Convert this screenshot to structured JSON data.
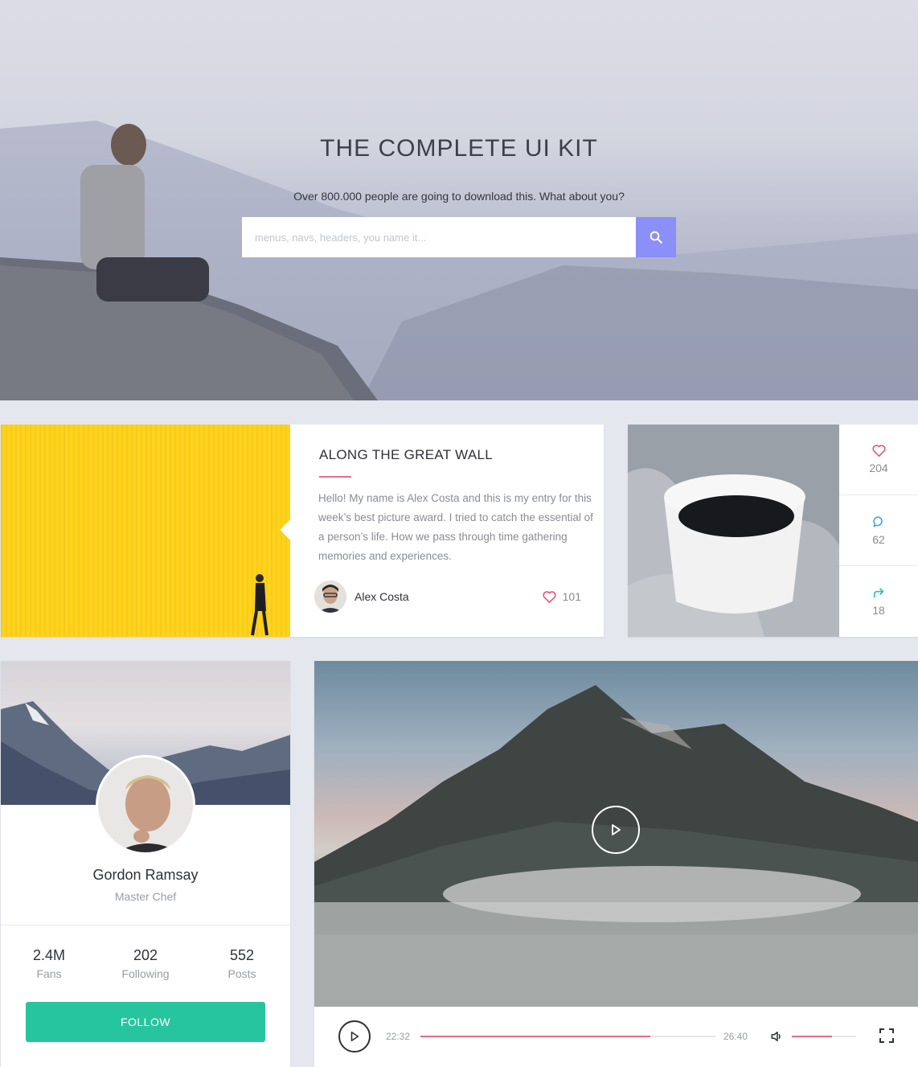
{
  "hero": {
    "title": "THE COMPLETE UI KIT",
    "subtitle": "Over 800.000 people are going to download this. What about you?",
    "search_placeholder": "menus, navs, headers, you name it...",
    "search_value": ""
  },
  "blog": {
    "title": "ALONG THE GREAT WALL",
    "body": "Hello! My name is Alex Costa and this is my entry for this week’s best picture award. I tried to catch the essential of a person’s life. How we pass through time gathering memories and experiences.",
    "author": "Alex Costa",
    "likes": "101"
  },
  "coffee": {
    "stats": [
      {
        "icon": "heart-icon",
        "value": "204"
      },
      {
        "icon": "comment-icon",
        "value": "62"
      },
      {
        "icon": "share-icon",
        "value": "18"
      }
    ]
  },
  "profile": {
    "name": "Gordon Ramsay",
    "role": "Master Chef",
    "stats": [
      {
        "value": "2.4M",
        "label": "Fans"
      },
      {
        "value": "202",
        "label": "Following"
      },
      {
        "value": "552",
        "label": "Posts"
      }
    ],
    "follow_label": "FOLLOW"
  },
  "video": {
    "current_time": "22:32",
    "end_time": "26:40",
    "progress": 0.78,
    "volume": 0.62
  },
  "colors": {
    "accent": "#8b8ff8",
    "pink": "#e96b8b",
    "heart": "#e8546e",
    "comment": "#2fa6e0",
    "share": "#26c59d",
    "follow": "#26c59d"
  }
}
